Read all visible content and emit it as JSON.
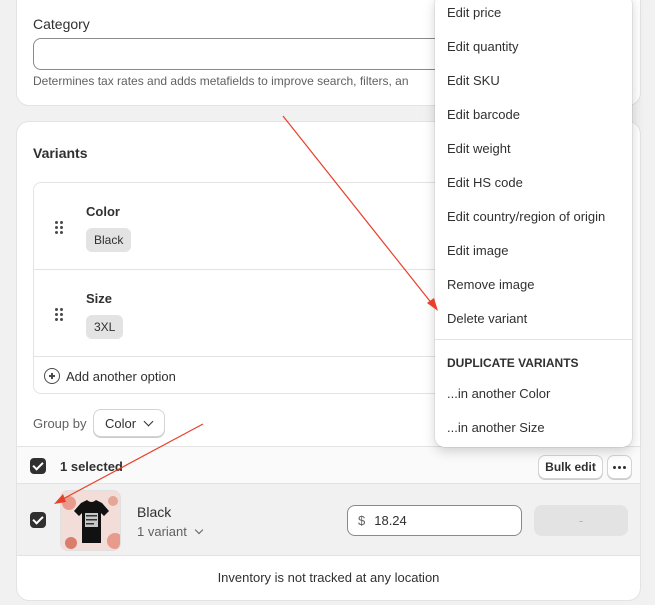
{
  "category": {
    "label": "Category",
    "input_value": "",
    "help_text": "Determines tax rates and adds metafields to improve search, filters, an"
  },
  "variants": {
    "title": "Variants",
    "options": [
      {
        "name": "Color",
        "values": [
          "Black"
        ]
      },
      {
        "name": "Size",
        "values": [
          "3XL"
        ]
      }
    ],
    "add_option_label": "Add another option",
    "group_by_label": "Group by",
    "group_by_value": "Color",
    "selection": {
      "count_label": "1 selected",
      "bulk_edit_label": "Bulk edit",
      "all_checked": true
    },
    "rows": [
      {
        "name": "Black",
        "variant_count_label": "1 variant",
        "checked": true,
        "price_currency": "$",
        "price_value": "18.24",
        "quantity_value": "-"
      }
    ],
    "inventory_note": "Inventory is not tracked at any location"
  },
  "menu": {
    "items": [
      "Edit price",
      "Edit quantity",
      "Edit SKU",
      "Edit barcode",
      "Edit weight",
      "Edit HS code",
      "Edit country/region of origin",
      "Edit image",
      "Remove image",
      "Delete variant"
    ],
    "duplicate_heading": "DUPLICATE VARIANTS",
    "duplicate_items": [
      "...in another Color",
      "...in another Size"
    ]
  },
  "colors": {
    "annotation_arrow": "#e8402a",
    "checkbox": "#303030",
    "page_background": "#f1f1f1"
  },
  "icons": {
    "drag_handle": "drag-handle-icon",
    "add_option": "plus-circle-icon",
    "more_actions": "ellipsis-icon",
    "dropdown": "chevron-down-icon"
  }
}
